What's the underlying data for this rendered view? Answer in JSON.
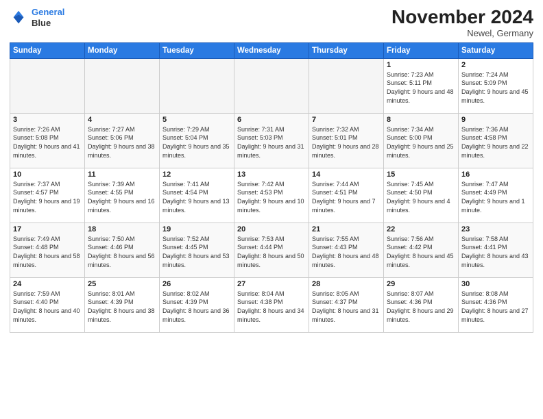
{
  "header": {
    "logo_line1": "General",
    "logo_line2": "Blue",
    "month_title": "November 2024",
    "location": "Newel, Germany"
  },
  "columns": [
    "Sunday",
    "Monday",
    "Tuesday",
    "Wednesday",
    "Thursday",
    "Friday",
    "Saturday"
  ],
  "weeks": [
    [
      {
        "day": "",
        "info": ""
      },
      {
        "day": "",
        "info": ""
      },
      {
        "day": "",
        "info": ""
      },
      {
        "day": "",
        "info": ""
      },
      {
        "day": "",
        "info": ""
      },
      {
        "day": "1",
        "info": "Sunrise: 7:23 AM\nSunset: 5:11 PM\nDaylight: 9 hours and 48 minutes."
      },
      {
        "day": "2",
        "info": "Sunrise: 7:24 AM\nSunset: 5:09 PM\nDaylight: 9 hours and 45 minutes."
      }
    ],
    [
      {
        "day": "3",
        "info": "Sunrise: 7:26 AM\nSunset: 5:08 PM\nDaylight: 9 hours and 41 minutes."
      },
      {
        "day": "4",
        "info": "Sunrise: 7:27 AM\nSunset: 5:06 PM\nDaylight: 9 hours and 38 minutes."
      },
      {
        "day": "5",
        "info": "Sunrise: 7:29 AM\nSunset: 5:04 PM\nDaylight: 9 hours and 35 minutes."
      },
      {
        "day": "6",
        "info": "Sunrise: 7:31 AM\nSunset: 5:03 PM\nDaylight: 9 hours and 31 minutes."
      },
      {
        "day": "7",
        "info": "Sunrise: 7:32 AM\nSunset: 5:01 PM\nDaylight: 9 hours and 28 minutes."
      },
      {
        "day": "8",
        "info": "Sunrise: 7:34 AM\nSunset: 5:00 PM\nDaylight: 9 hours and 25 minutes."
      },
      {
        "day": "9",
        "info": "Sunrise: 7:36 AM\nSunset: 4:58 PM\nDaylight: 9 hours and 22 minutes."
      }
    ],
    [
      {
        "day": "10",
        "info": "Sunrise: 7:37 AM\nSunset: 4:57 PM\nDaylight: 9 hours and 19 minutes."
      },
      {
        "day": "11",
        "info": "Sunrise: 7:39 AM\nSunset: 4:55 PM\nDaylight: 9 hours and 16 minutes."
      },
      {
        "day": "12",
        "info": "Sunrise: 7:41 AM\nSunset: 4:54 PM\nDaylight: 9 hours and 13 minutes."
      },
      {
        "day": "13",
        "info": "Sunrise: 7:42 AM\nSunset: 4:53 PM\nDaylight: 9 hours and 10 minutes."
      },
      {
        "day": "14",
        "info": "Sunrise: 7:44 AM\nSunset: 4:51 PM\nDaylight: 9 hours and 7 minutes."
      },
      {
        "day": "15",
        "info": "Sunrise: 7:45 AM\nSunset: 4:50 PM\nDaylight: 9 hours and 4 minutes."
      },
      {
        "day": "16",
        "info": "Sunrise: 7:47 AM\nSunset: 4:49 PM\nDaylight: 9 hours and 1 minute."
      }
    ],
    [
      {
        "day": "17",
        "info": "Sunrise: 7:49 AM\nSunset: 4:48 PM\nDaylight: 8 hours and 58 minutes."
      },
      {
        "day": "18",
        "info": "Sunrise: 7:50 AM\nSunset: 4:46 PM\nDaylight: 8 hours and 56 minutes."
      },
      {
        "day": "19",
        "info": "Sunrise: 7:52 AM\nSunset: 4:45 PM\nDaylight: 8 hours and 53 minutes."
      },
      {
        "day": "20",
        "info": "Sunrise: 7:53 AM\nSunset: 4:44 PM\nDaylight: 8 hours and 50 minutes."
      },
      {
        "day": "21",
        "info": "Sunrise: 7:55 AM\nSunset: 4:43 PM\nDaylight: 8 hours and 48 minutes."
      },
      {
        "day": "22",
        "info": "Sunrise: 7:56 AM\nSunset: 4:42 PM\nDaylight: 8 hours and 45 minutes."
      },
      {
        "day": "23",
        "info": "Sunrise: 7:58 AM\nSunset: 4:41 PM\nDaylight: 8 hours and 43 minutes."
      }
    ],
    [
      {
        "day": "24",
        "info": "Sunrise: 7:59 AM\nSunset: 4:40 PM\nDaylight: 8 hours and 40 minutes."
      },
      {
        "day": "25",
        "info": "Sunrise: 8:01 AM\nSunset: 4:39 PM\nDaylight: 8 hours and 38 minutes."
      },
      {
        "day": "26",
        "info": "Sunrise: 8:02 AM\nSunset: 4:39 PM\nDaylight: 8 hours and 36 minutes."
      },
      {
        "day": "27",
        "info": "Sunrise: 8:04 AM\nSunset: 4:38 PM\nDaylight: 8 hours and 34 minutes."
      },
      {
        "day": "28",
        "info": "Sunrise: 8:05 AM\nSunset: 4:37 PM\nDaylight: 8 hours and 31 minutes."
      },
      {
        "day": "29",
        "info": "Sunrise: 8:07 AM\nSunset: 4:36 PM\nDaylight: 8 hours and 29 minutes."
      },
      {
        "day": "30",
        "info": "Sunrise: 8:08 AM\nSunset: 4:36 PM\nDaylight: 8 hours and 27 minutes."
      }
    ]
  ]
}
